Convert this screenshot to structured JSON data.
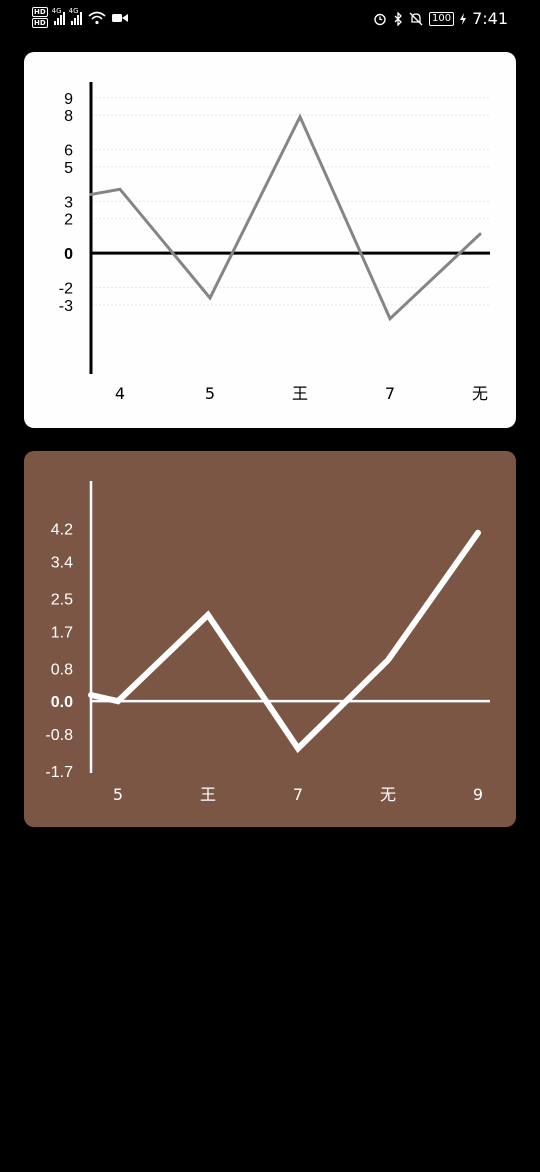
{
  "status_bar": {
    "hd_badges": [
      "HD",
      "HD"
    ],
    "network_labels": [
      "4G",
      "4G"
    ],
    "battery": "100",
    "time": "7:41",
    "icons": [
      "hd-icon",
      "signal-icon",
      "wifi-icon",
      "video-call-icon",
      "alarm-icon",
      "bluetooth-icon",
      "mute-icon",
      "battery-icon",
      "charging-icon"
    ]
  },
  "colors": {
    "card1_bg": "#fdfefd",
    "card1_line": "#858585",
    "card1_axis": "#000000",
    "card2_bg": "#7b5644",
    "card2_line": "#ffffff"
  },
  "chart_data": [
    {
      "type": "line",
      "categories": [
        "4",
        "5",
        "王",
        "7",
        "无"
      ],
      "y_ticks": [
        "9",
        "8",
        "6",
        "5",
        "3",
        "2",
        "0",
        "-2",
        "-3"
      ],
      "series": [
        {
          "x": [
            -0.3,
            0,
            1,
            2,
            3,
            4
          ],
          "y": [
            3.4,
            3.7,
            -2.6,
            7.9,
            -3.8,
            1.1
          ]
        }
      ],
      "ylim": [
        -5.5,
        9.8
      ],
      "grid": true
    },
    {
      "type": "line",
      "categories": [
        "5",
        "王",
        "7",
        "无",
        "9"
      ],
      "y_ticks": [
        "4.2",
        "3.4",
        "2.5",
        "1.7",
        "0.8",
        "0.0",
        "-0.8",
        "-1.7"
      ],
      "series": [
        {
          "x": [
            -0.3,
            0,
            1,
            2,
            3,
            4
          ],
          "y": [
            0.15,
            0.0,
            2.1,
            -1.15,
            1.0,
            4.1
          ]
        }
      ],
      "ylim": [
        -1.7,
        4.8
      ],
      "grid": false
    }
  ]
}
